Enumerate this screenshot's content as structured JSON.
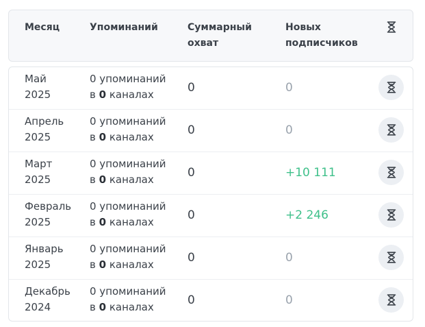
{
  "header": {
    "month": "Месяц",
    "mentions": "Упоминаний",
    "reach_line1": "Суммарный",
    "reach_line2": "охват",
    "subs_line1": "Новых",
    "subs_line2": "подписчиков",
    "icon": "hourglass-icon"
  },
  "rows": [
    {
      "month_name": "Май",
      "year": "2025",
      "mentions_text": "0 упоминаний",
      "channels_prefix": "в",
      "channels_count": "0",
      "channels_suffix": "каналах",
      "reach": "0",
      "subs": "0",
      "subs_state": "zero"
    },
    {
      "month_name": "Апрель",
      "year": "2025",
      "mentions_text": "0 упоминаний",
      "channels_prefix": "в",
      "channels_count": "0",
      "channels_suffix": "каналах",
      "reach": "0",
      "subs": "0",
      "subs_state": "zero"
    },
    {
      "month_name": "Март",
      "year": "2025",
      "mentions_text": "0 упоминаний",
      "channels_prefix": "в",
      "channels_count": "0",
      "channels_suffix": "каналах",
      "reach": "0",
      "subs": "+10 111",
      "subs_state": "positive"
    },
    {
      "month_name": "Февраль",
      "year": "2025",
      "mentions_text": "0 упоминаний",
      "channels_prefix": "в",
      "channels_count": "0",
      "channels_suffix": "каналах",
      "reach": "0",
      "subs": "+2 246",
      "subs_state": "positive"
    },
    {
      "month_name": "Январь",
      "year": "2025",
      "mentions_text": "0 упоминаний",
      "channels_prefix": "в",
      "channels_count": "0",
      "channels_suffix": "каналах",
      "reach": "0",
      "subs": "0",
      "subs_state": "zero"
    },
    {
      "month_name": "Декабрь",
      "year": "2024",
      "mentions_text": "0 упоминаний",
      "channels_prefix": "в",
      "channels_count": "0",
      "channels_suffix": "каналах",
      "reach": "0",
      "subs": "0",
      "subs_state": "zero"
    }
  ],
  "colors": {
    "positive": "#3fc08a",
    "zero": "#9aa3ad",
    "header_bg": "#f7f8fa",
    "button_bg": "#eceff3"
  }
}
